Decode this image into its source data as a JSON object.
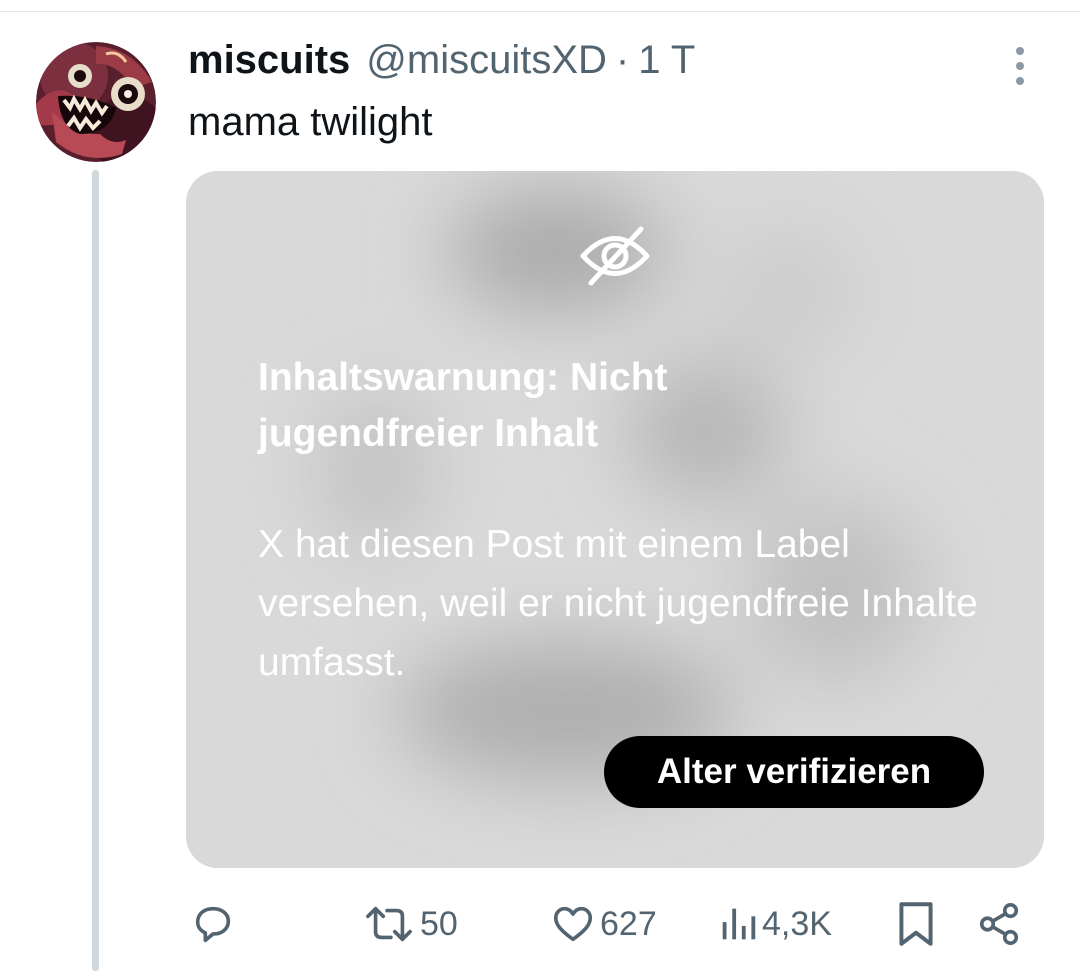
{
  "tweet": {
    "display_name": "miscuits",
    "handle": "@miscuitsXD",
    "separator": "·",
    "time": "1 T",
    "text": "mama twilight",
    "avatar_icon": "cartoon-face-avatar"
  },
  "content_warning": {
    "icon": "eye-slash-icon",
    "title": "Inhaltswarnung: Nicht jugendfreier Inhalt",
    "body": "X hat diesen Post mit einem Label versehen, weil er nicht jugendfreie Inhalte umfasst.",
    "button_label": "Alter verifizieren"
  },
  "actions": {
    "reply": {
      "icon": "reply-icon"
    },
    "repost": {
      "icon": "repost-icon",
      "count": "50"
    },
    "like": {
      "icon": "heart-icon",
      "count": "627"
    },
    "views": {
      "icon": "views-icon",
      "count": "4,3K"
    },
    "bookmark": {
      "icon": "bookmark-icon"
    },
    "share": {
      "icon": "share-icon"
    }
  },
  "colors": {
    "text_primary": "#0f1419",
    "text_secondary": "#536471",
    "thread_line": "#cfd9de",
    "card_background": "#d9d9d9",
    "button_background": "#000000",
    "button_text": "#ffffff"
  }
}
